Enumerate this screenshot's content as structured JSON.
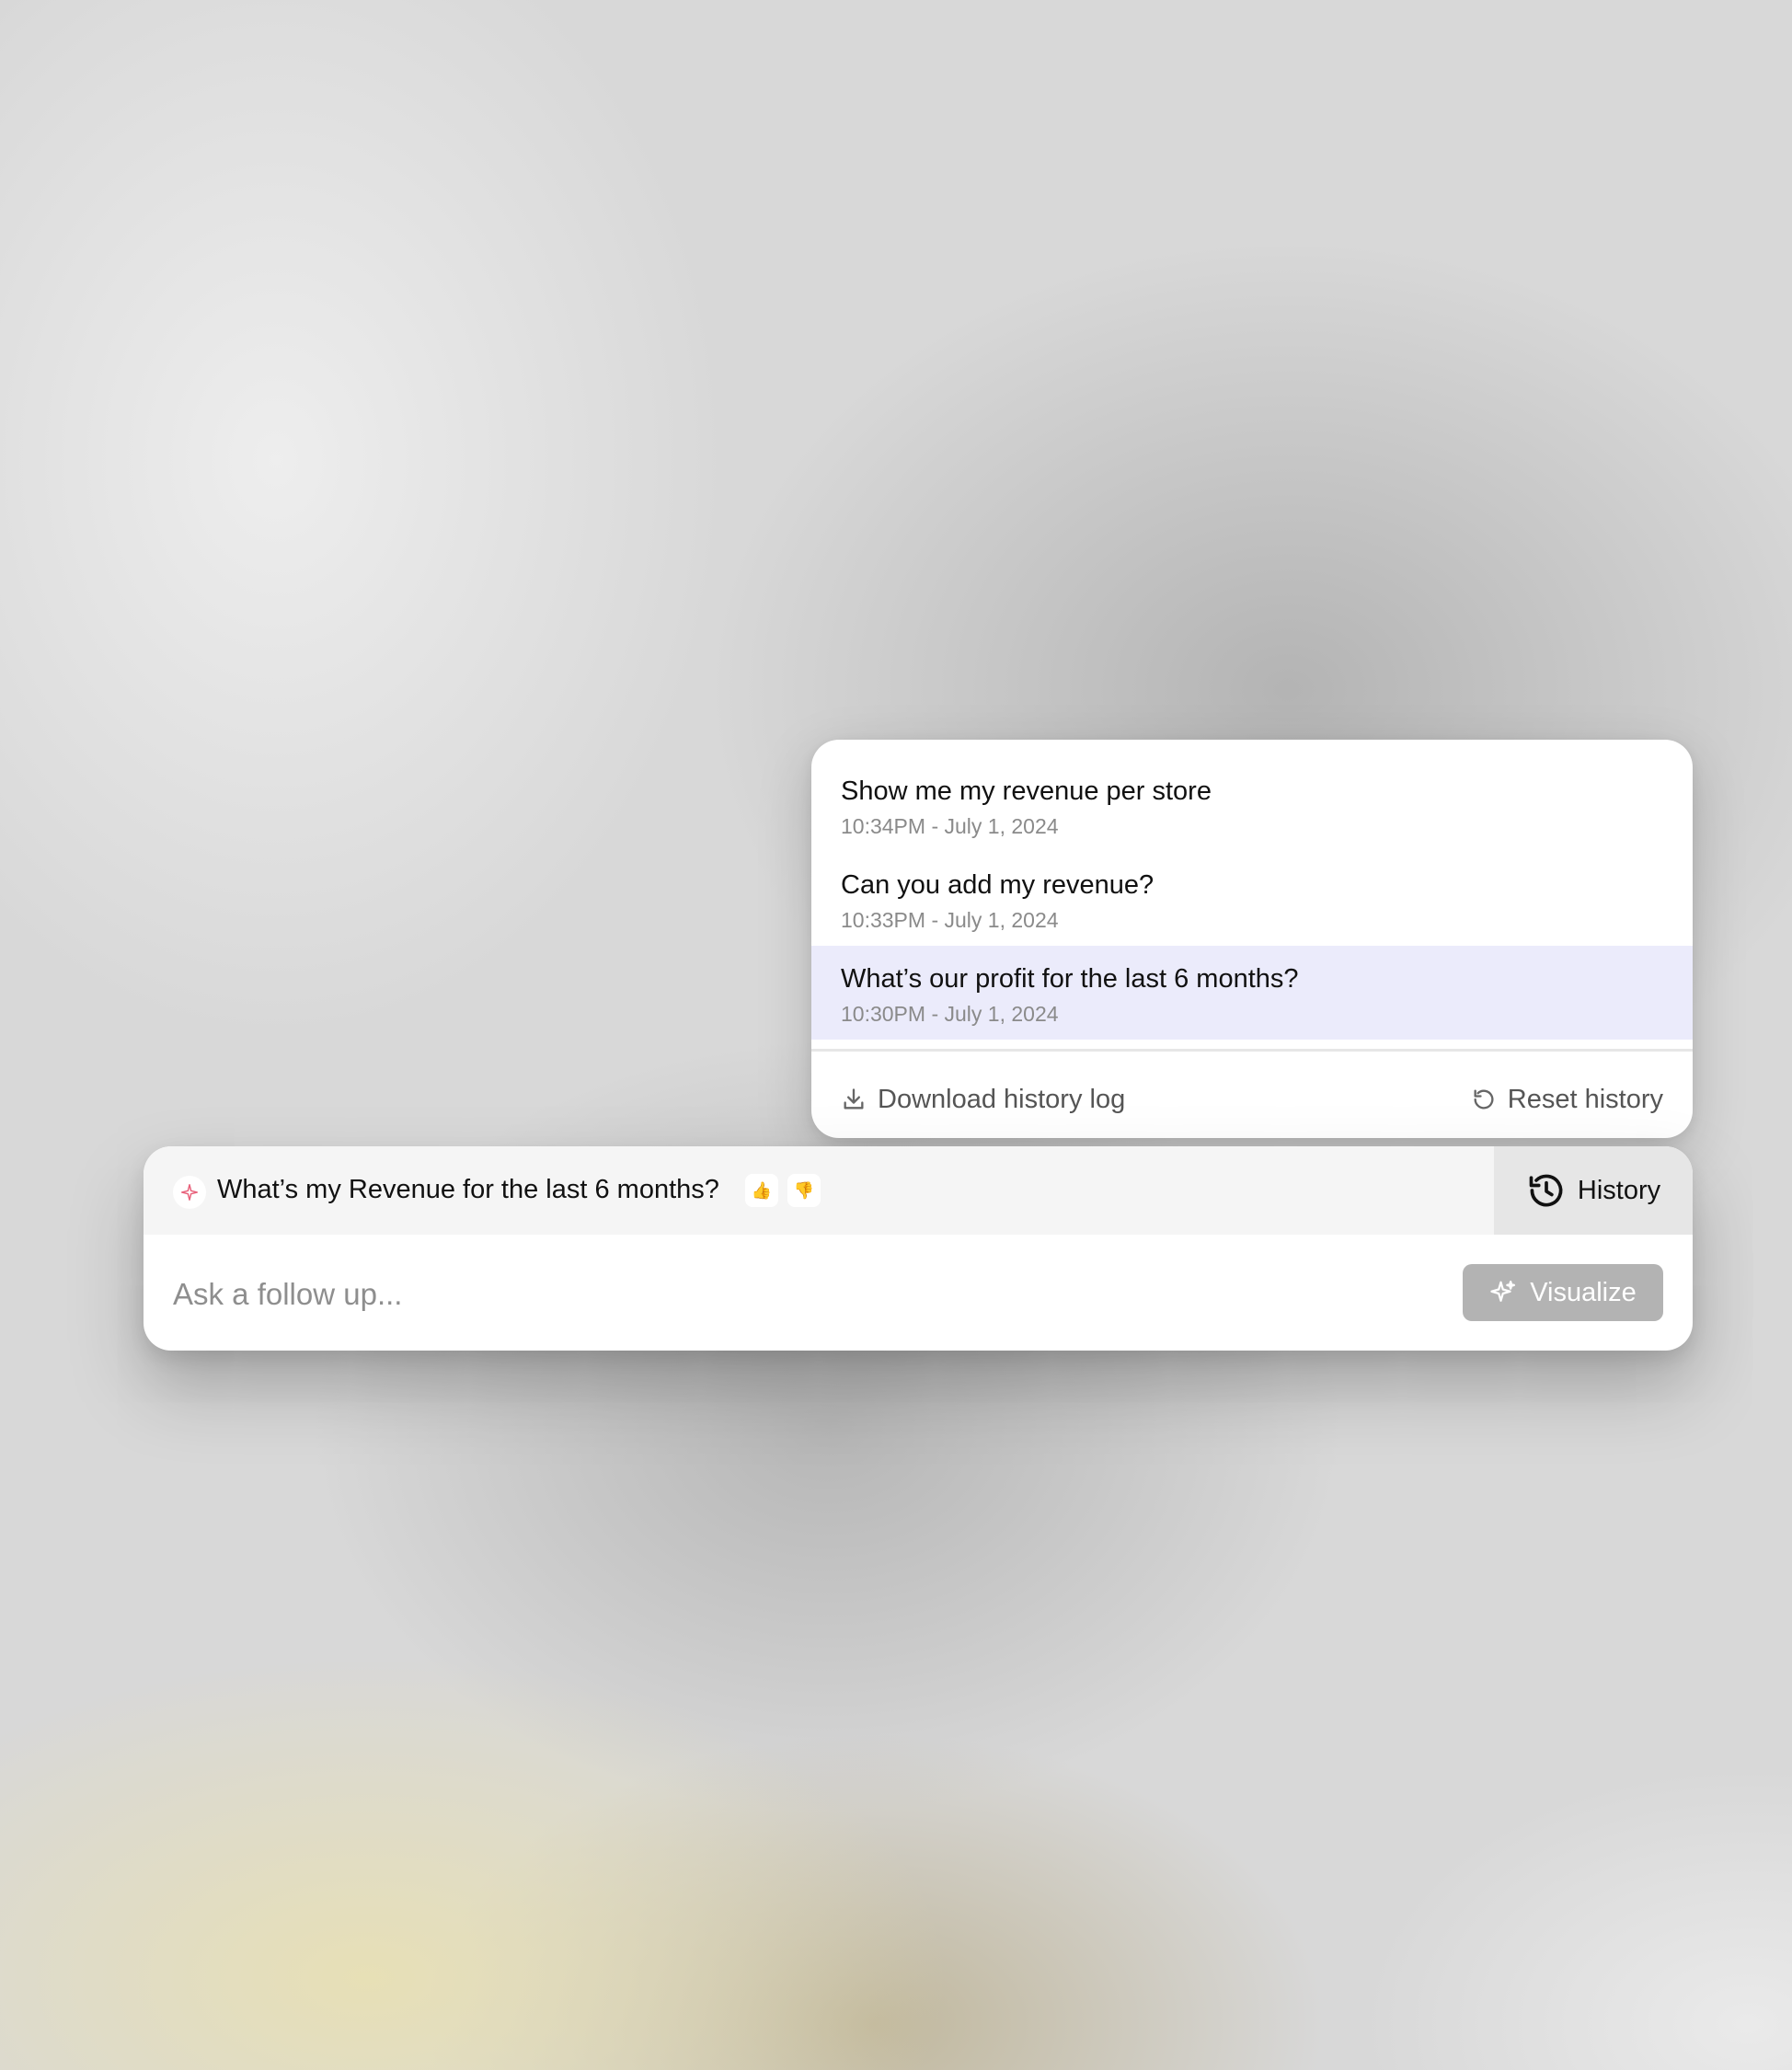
{
  "history": {
    "items": [
      {
        "question": "Show me my revenue per store",
        "time": "10:34PM - July 1, 2024",
        "selected": false
      },
      {
        "question": "Can you add my revenue?",
        "time": "10:33PM - July 1, 2024",
        "selected": false
      },
      {
        "question": "What’s our profit for the last 6 months?",
        "time": "10:30PM - July 1, 2024",
        "selected": true
      }
    ],
    "download_label": "Download history log",
    "reset_label": "Reset history"
  },
  "query_bar": {
    "current_query": "What’s my Revenue for the last 6 months?",
    "thumbs_up": "👍",
    "thumbs_down": "👎",
    "history_label": "History",
    "followup_placeholder": "Ask a follow up...",
    "visualize_label": "Visualize"
  },
  "colors": {
    "selected_row": "#ebebfb",
    "visualize_bg": "#b3b3b3",
    "history_tab_bg": "#e6e6e6"
  }
}
